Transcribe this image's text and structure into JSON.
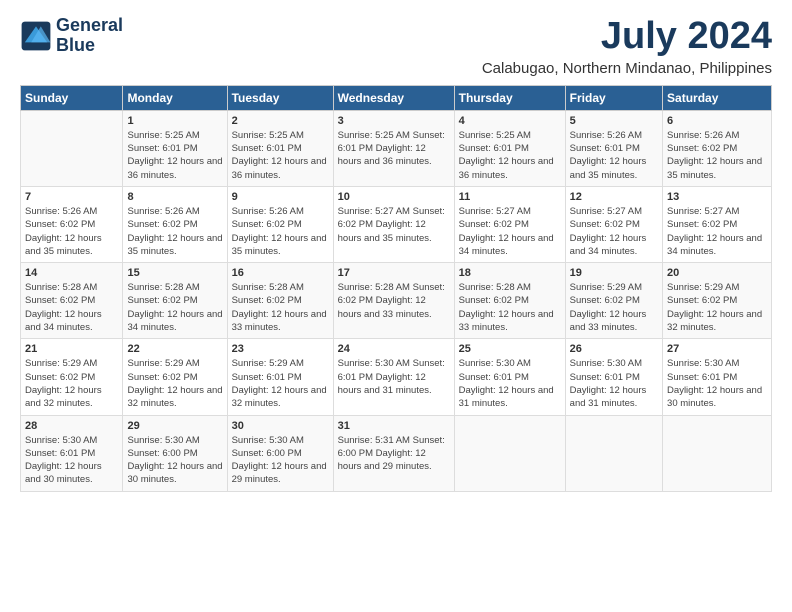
{
  "logo": {
    "line1": "General",
    "line2": "Blue"
  },
  "title": "July 2024",
  "subtitle": "Calabugao, Northern Mindanao, Philippines",
  "weekdays": [
    "Sunday",
    "Monday",
    "Tuesday",
    "Wednesday",
    "Thursday",
    "Friday",
    "Saturday"
  ],
  "weeks": [
    [
      {
        "day": "",
        "text": ""
      },
      {
        "day": "1",
        "text": "Sunrise: 5:25 AM\nSunset: 6:01 PM\nDaylight: 12 hours\nand 36 minutes."
      },
      {
        "day": "2",
        "text": "Sunrise: 5:25 AM\nSunset: 6:01 PM\nDaylight: 12 hours\nand 36 minutes."
      },
      {
        "day": "3",
        "text": "Sunrise: 5:25 AM\nSunset: 6:01 PM\nDaylight: 12 hours\nand 36 minutes."
      },
      {
        "day": "4",
        "text": "Sunrise: 5:25 AM\nSunset: 6:01 PM\nDaylight: 12 hours\nand 36 minutes."
      },
      {
        "day": "5",
        "text": "Sunrise: 5:26 AM\nSunset: 6:01 PM\nDaylight: 12 hours\nand 35 minutes."
      },
      {
        "day": "6",
        "text": "Sunrise: 5:26 AM\nSunset: 6:02 PM\nDaylight: 12 hours\nand 35 minutes."
      }
    ],
    [
      {
        "day": "7",
        "text": "Sunrise: 5:26 AM\nSunset: 6:02 PM\nDaylight: 12 hours\nand 35 minutes."
      },
      {
        "day": "8",
        "text": "Sunrise: 5:26 AM\nSunset: 6:02 PM\nDaylight: 12 hours\nand 35 minutes."
      },
      {
        "day": "9",
        "text": "Sunrise: 5:26 AM\nSunset: 6:02 PM\nDaylight: 12 hours\nand 35 minutes."
      },
      {
        "day": "10",
        "text": "Sunrise: 5:27 AM\nSunset: 6:02 PM\nDaylight: 12 hours\nand 35 minutes."
      },
      {
        "day": "11",
        "text": "Sunrise: 5:27 AM\nSunset: 6:02 PM\nDaylight: 12 hours\nand 34 minutes."
      },
      {
        "day": "12",
        "text": "Sunrise: 5:27 AM\nSunset: 6:02 PM\nDaylight: 12 hours\nand 34 minutes."
      },
      {
        "day": "13",
        "text": "Sunrise: 5:27 AM\nSunset: 6:02 PM\nDaylight: 12 hours\nand 34 minutes."
      }
    ],
    [
      {
        "day": "14",
        "text": "Sunrise: 5:28 AM\nSunset: 6:02 PM\nDaylight: 12 hours\nand 34 minutes."
      },
      {
        "day": "15",
        "text": "Sunrise: 5:28 AM\nSunset: 6:02 PM\nDaylight: 12 hours\nand 34 minutes."
      },
      {
        "day": "16",
        "text": "Sunrise: 5:28 AM\nSunset: 6:02 PM\nDaylight: 12 hours\nand 33 minutes."
      },
      {
        "day": "17",
        "text": "Sunrise: 5:28 AM\nSunset: 6:02 PM\nDaylight: 12 hours\nand 33 minutes."
      },
      {
        "day": "18",
        "text": "Sunrise: 5:28 AM\nSunset: 6:02 PM\nDaylight: 12 hours\nand 33 minutes."
      },
      {
        "day": "19",
        "text": "Sunrise: 5:29 AM\nSunset: 6:02 PM\nDaylight: 12 hours\nand 33 minutes."
      },
      {
        "day": "20",
        "text": "Sunrise: 5:29 AM\nSunset: 6:02 PM\nDaylight: 12 hours\nand 32 minutes."
      }
    ],
    [
      {
        "day": "21",
        "text": "Sunrise: 5:29 AM\nSunset: 6:02 PM\nDaylight: 12 hours\nand 32 minutes."
      },
      {
        "day": "22",
        "text": "Sunrise: 5:29 AM\nSunset: 6:02 PM\nDaylight: 12 hours\nand 32 minutes."
      },
      {
        "day": "23",
        "text": "Sunrise: 5:29 AM\nSunset: 6:01 PM\nDaylight: 12 hours\nand 32 minutes."
      },
      {
        "day": "24",
        "text": "Sunrise: 5:30 AM\nSunset: 6:01 PM\nDaylight: 12 hours\nand 31 minutes."
      },
      {
        "day": "25",
        "text": "Sunrise: 5:30 AM\nSunset: 6:01 PM\nDaylight: 12 hours\nand 31 minutes."
      },
      {
        "day": "26",
        "text": "Sunrise: 5:30 AM\nSunset: 6:01 PM\nDaylight: 12 hours\nand 31 minutes."
      },
      {
        "day": "27",
        "text": "Sunrise: 5:30 AM\nSunset: 6:01 PM\nDaylight: 12 hours\nand 30 minutes."
      }
    ],
    [
      {
        "day": "28",
        "text": "Sunrise: 5:30 AM\nSunset: 6:01 PM\nDaylight: 12 hours\nand 30 minutes."
      },
      {
        "day": "29",
        "text": "Sunrise: 5:30 AM\nSunset: 6:00 PM\nDaylight: 12 hours\nand 30 minutes."
      },
      {
        "day": "30",
        "text": "Sunrise: 5:30 AM\nSunset: 6:00 PM\nDaylight: 12 hours\nand 29 minutes."
      },
      {
        "day": "31",
        "text": "Sunrise: 5:31 AM\nSunset: 6:00 PM\nDaylight: 12 hours\nand 29 minutes."
      },
      {
        "day": "",
        "text": ""
      },
      {
        "day": "",
        "text": ""
      },
      {
        "day": "",
        "text": ""
      }
    ]
  ]
}
